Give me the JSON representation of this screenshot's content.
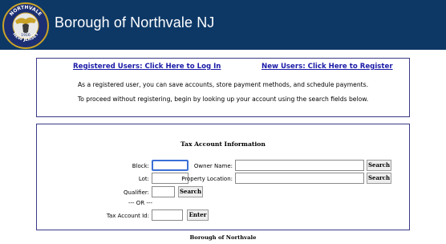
{
  "header": {
    "title": "Borough of Northvale NJ",
    "seal": {
      "top_text": "NORTHVALE",
      "bottom_text": "NEW JERSEY",
      "year": "1916"
    }
  },
  "auth": {
    "login_link": "Registered Users: Click Here to Log In",
    "register_link": "New Users: Click Here to Register",
    "info_line1": "As a registered user, you can save accounts, store payment methods, and schedule payments.",
    "info_line2": "To proceed without registering, begin by looking up your account using the search fields below."
  },
  "tax_form": {
    "title": "Tax Account Information",
    "block_label": "Block:",
    "lot_label": "Lot:",
    "qualifier_label": "Qualifier:",
    "or_text": "--- OR ---",
    "tax_account_label": "Tax Account Id:",
    "owner_name_label": "Owner Name:",
    "property_location_label": "Property Location:",
    "search_label": "Search",
    "enter_label": "Enter",
    "block_value": "",
    "lot_value": "",
    "qualifier_value": "",
    "tax_account_value": "",
    "owner_name_value": "",
    "property_location_value": ""
  },
  "footer": {
    "text": "Borough of Northvale"
  },
  "colors": {
    "header_bg": "#0d3866",
    "panel_border": "#3a3a8a",
    "link": "#1a1aa8",
    "focus": "#3b6fd6"
  }
}
